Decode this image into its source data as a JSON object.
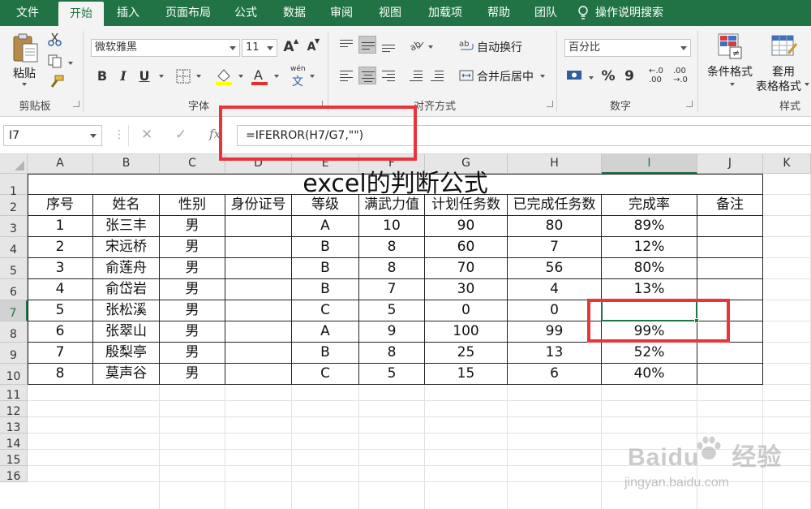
{
  "ribbon_tabs": [
    "文件",
    "开始",
    "插入",
    "页面布局",
    "公式",
    "数据",
    "审阅",
    "视图",
    "加载项",
    "帮助",
    "团队"
  ],
  "active_tab": "开始",
  "tell_me": "操作说明搜索",
  "clipboard": {
    "paste": "粘贴",
    "group": "剪贴板"
  },
  "font": {
    "name": "微软雅黑",
    "size": "11",
    "group": "字体",
    "bold": "B",
    "italic": "I",
    "underline": "U",
    "grow": "A",
    "shrink": "A",
    "phonetic_top": "wén",
    "phonetic_bottom": "文"
  },
  "alignment": {
    "wrap": "自动换行",
    "merge": "合并后居中",
    "group": "对齐方式"
  },
  "number": {
    "format": "百分比",
    "group": "数字",
    "percent": "%",
    "comma": "9",
    "inc_decimal_top": "←.0",
    "inc_decimal_bottom": ".00",
    "dec_decimal_top": ".00",
    "dec_decimal_bottom": "→.0"
  },
  "styles": {
    "conditional": "条件格式",
    "table_line1": "套用",
    "table_line2": "表格格式",
    "group": "样式"
  },
  "formula_bar": {
    "name_box": "I7",
    "fx": "fx",
    "formula": "=IFERROR(H7/G7,\"\")"
  },
  "columns": [
    "A",
    "B",
    "C",
    "D",
    "E",
    "F",
    "G",
    "H",
    "I",
    "J",
    "K"
  ],
  "rows": [
    "1",
    "2",
    "3",
    "4",
    "5",
    "6",
    "7",
    "8",
    "9",
    "10",
    "11",
    "12",
    "13",
    "14",
    "15",
    "16"
  ],
  "selected_column": "I",
  "selected_row": "7",
  "table": {
    "title": "excel的判断公式",
    "headers": [
      "序号",
      "姓名",
      "性别",
      "身份证号",
      "等级",
      "满武力值",
      "计划任务数",
      "已完成任务数",
      "完成率",
      "备注"
    ],
    "rows": [
      [
        "1",
        "张三丰",
        "男",
        "",
        "A",
        "10",
        "90",
        "80",
        "89%",
        ""
      ],
      [
        "2",
        "宋远桥",
        "男",
        "",
        "B",
        "8",
        "60",
        "7",
        "12%",
        ""
      ],
      [
        "3",
        "俞莲舟",
        "男",
        "",
        "B",
        "8",
        "70",
        "56",
        "80%",
        ""
      ],
      [
        "4",
        "俞岱岩",
        "男",
        "",
        "B",
        "7",
        "30",
        "4",
        "13%",
        ""
      ],
      [
        "5",
        "张松溪",
        "男",
        "",
        "C",
        "5",
        "0",
        "0",
        "",
        ""
      ],
      [
        "6",
        "张翠山",
        "男",
        "",
        "A",
        "9",
        "100",
        "99",
        "99%",
        ""
      ],
      [
        "7",
        "殷梨亭",
        "男",
        "",
        "B",
        "8",
        "25",
        "13",
        "52%",
        ""
      ],
      [
        "8",
        "莫声谷",
        "男",
        "",
        "C",
        "5",
        "15",
        "6",
        "40%",
        ""
      ]
    ]
  },
  "watermark": {
    "brand": "Baidu",
    "cn": "经验",
    "site": "jingyan.baidu.com"
  },
  "colors": {
    "excel_green": "#217346",
    "annotation_red": "#e8343a"
  }
}
